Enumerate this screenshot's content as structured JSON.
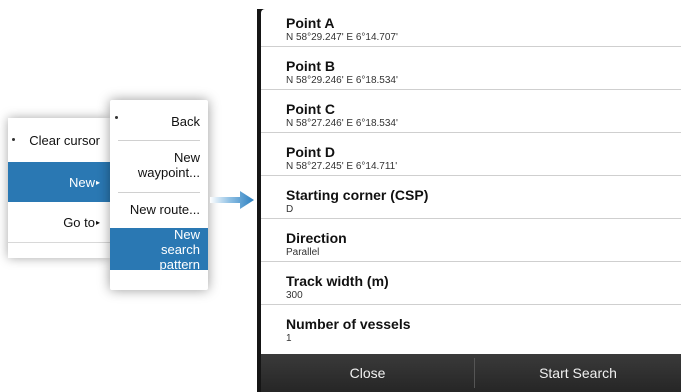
{
  "context_menu": {
    "items": [
      {
        "label": "Clear cursor"
      },
      {
        "label": "New"
      },
      {
        "label": "Go to"
      }
    ]
  },
  "submenu": {
    "items": [
      {
        "label": "Back"
      },
      {
        "label": "New waypoint..."
      },
      {
        "label": "New route..."
      },
      {
        "label": "New search pattern"
      }
    ]
  },
  "dialog": {
    "fields": [
      {
        "label": "Point A",
        "value": "N  58°29.247' E  6°14.707'"
      },
      {
        "label": "Point B",
        "value": "N  58°29.246' E  6°18.534'"
      },
      {
        "label": "Point C",
        "value": "N  58°27.246' E  6°18.534'"
      },
      {
        "label": "Point D",
        "value": "N  58°27.245' E  6°14.711'"
      },
      {
        "label": "Starting corner (CSP)",
        "value": "D"
      },
      {
        "label": "Direction",
        "value": "Parallel"
      },
      {
        "label": "Track width (m)",
        "value": "300"
      },
      {
        "label": "Number of vessels",
        "value": "1"
      }
    ],
    "footer": {
      "close_label": "Close",
      "start_label": "Start Search"
    }
  },
  "colors": {
    "accent": "#2a78b3",
    "footer": "#2e2e2e",
    "frame": "#151515"
  }
}
